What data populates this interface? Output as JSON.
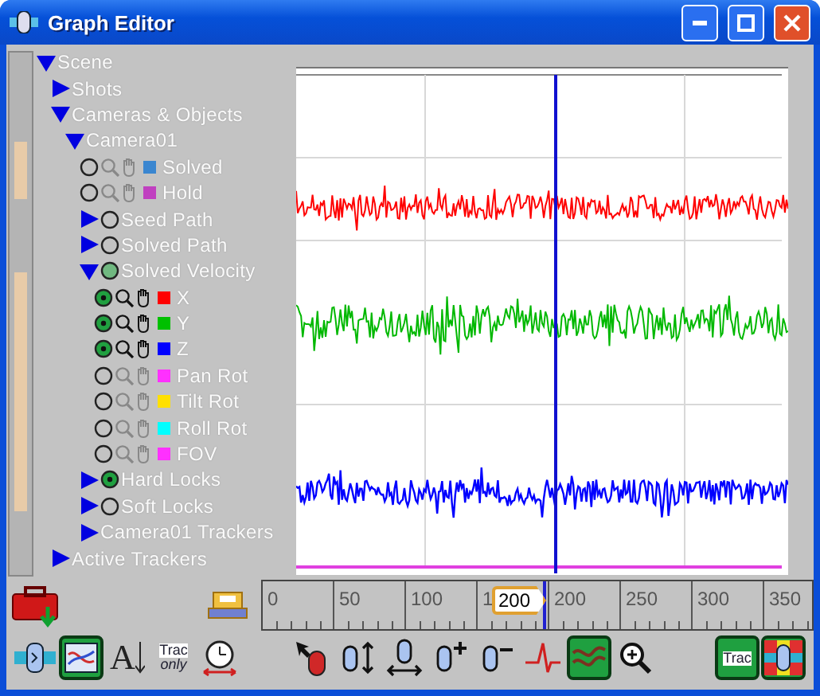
{
  "window": {
    "title": "Graph Editor"
  },
  "tree": [
    {
      "kind": "group",
      "label": "Scene",
      "expanded": true,
      "children": [
        {
          "kind": "group",
          "label": "Shots",
          "expanded": false
        },
        {
          "kind": "group",
          "label": "Cameras & Objects",
          "expanded": true,
          "children": [
            {
              "kind": "group",
              "label": "Camera01",
              "expanded": true,
              "children": [
                {
                  "kind": "channel",
                  "label": "Solved",
                  "visible": false,
                  "color": "#3a86d0"
                },
                {
                  "kind": "channel",
                  "label": "Hold",
                  "visible": false,
                  "color": "#c040c0"
                },
                {
                  "kind": "group",
                  "label": "Seed Path",
                  "expanded": false,
                  "visible": false
                },
                {
                  "kind": "group",
                  "label": "Solved Path",
                  "expanded": false,
                  "visible": false
                },
                {
                  "kind": "group",
                  "label": "Solved Velocity",
                  "expanded": true,
                  "visible": true,
                  "partial": true,
                  "children": [
                    {
                      "kind": "channel",
                      "label": "X",
                      "visible": true,
                      "color": "#ff0000"
                    },
                    {
                      "kind": "channel",
                      "label": "Y",
                      "visible": true,
                      "color": "#00c000"
                    },
                    {
                      "kind": "channel",
                      "label": "Z",
                      "visible": true,
                      "color": "#0000ff"
                    },
                    {
                      "kind": "channel",
                      "label": "Pan Rot",
                      "visible": false,
                      "color": "#ff30ff"
                    },
                    {
                      "kind": "channel",
                      "label": "Tilt Rot",
                      "visible": false,
                      "color": "#ffe000"
                    },
                    {
                      "kind": "channel",
                      "label": "Roll Rot",
                      "visible": false,
                      "color": "#00ffff"
                    },
                    {
                      "kind": "channel",
                      "label": "FOV",
                      "visible": false,
                      "color": "#ff30ff"
                    }
                  ]
                },
                {
                  "kind": "group",
                  "label": "Hard Locks",
                  "expanded": false,
                  "visible": true
                },
                {
                  "kind": "group",
                  "label": "Soft Locks",
                  "expanded": false,
                  "visible": false
                },
                {
                  "kind": "group",
                  "label": "Camera01 Trackers",
                  "expanded": false
                }
              ]
            }
          ]
        },
        {
          "kind": "group",
          "label": "Active Trackers",
          "expanded": false
        }
      ]
    }
  ],
  "ruler": {
    "labels": [
      "0",
      "50",
      "100",
      "1",
      "200",
      "250",
      "300",
      "350"
    ],
    "current_frame": "200"
  },
  "toolbar_left": [
    {
      "kind": "channels",
      "selected": false
    },
    {
      "kind": "graph",
      "selected": true
    },
    {
      "kind": "sort",
      "text": "A",
      "selected": false
    },
    {
      "kind": "trac",
      "text": "Trac",
      "subtext": "only",
      "selected": false
    },
    {
      "kind": "clock",
      "selected": false
    }
  ],
  "toolbar_mid": [
    {
      "kind": "pointer",
      "selected": false
    },
    {
      "kind": "vscale",
      "selected": false
    },
    {
      "kind": "hscale",
      "selected": false
    },
    {
      "kind": "plus",
      "selected": false
    },
    {
      "kind": "minus",
      "selected": false
    },
    {
      "kind": "spike",
      "selected": false
    },
    {
      "kind": "waves",
      "selected": true
    },
    {
      "kind": "zoom",
      "selected": false
    }
  ],
  "toolbar_right": [
    {
      "kind": "tracview",
      "text": "Trac",
      "selected": true
    },
    {
      "kind": "colors",
      "selected": true
    }
  ]
}
